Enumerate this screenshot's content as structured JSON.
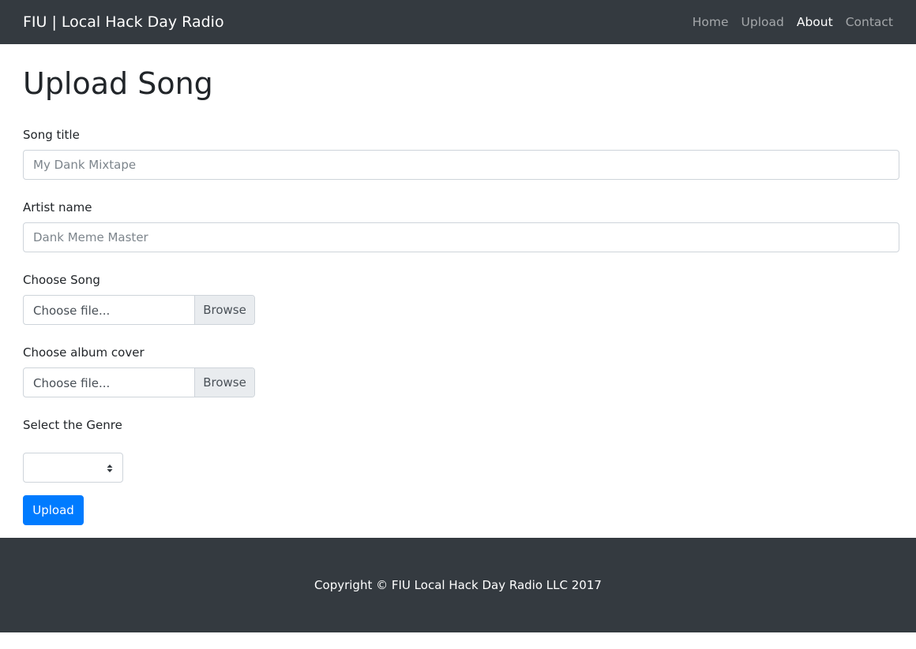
{
  "navbar": {
    "brand": "FIU | Local Hack Day Radio",
    "links": [
      {
        "label": "Home",
        "active": false
      },
      {
        "label": "Upload",
        "active": false
      },
      {
        "label": "About",
        "active": true
      },
      {
        "label": "Contact",
        "active": false
      }
    ]
  },
  "page": {
    "title": "Upload Song"
  },
  "form": {
    "song_title": {
      "label": "Song title",
      "placeholder": "My Dank Mixtape",
      "value": ""
    },
    "artist_name": {
      "label": "Artist name",
      "placeholder": "Dank Meme Master",
      "value": ""
    },
    "song_file": {
      "label": "Choose Song",
      "text": "Choose file...",
      "button": "Browse"
    },
    "cover_file": {
      "label": "Choose album cover",
      "text": "Choose file...",
      "button": "Browse"
    },
    "genre": {
      "label": "Select the Genre",
      "selected": ""
    },
    "submit_label": "Upload"
  },
  "footer": {
    "copyright": "Copyright © FIU Local Hack Day Radio LLC 2017"
  },
  "colors": {
    "navbar_bg": "#343a40",
    "primary": "#007bff",
    "browse_bg": "#e9ecef"
  }
}
